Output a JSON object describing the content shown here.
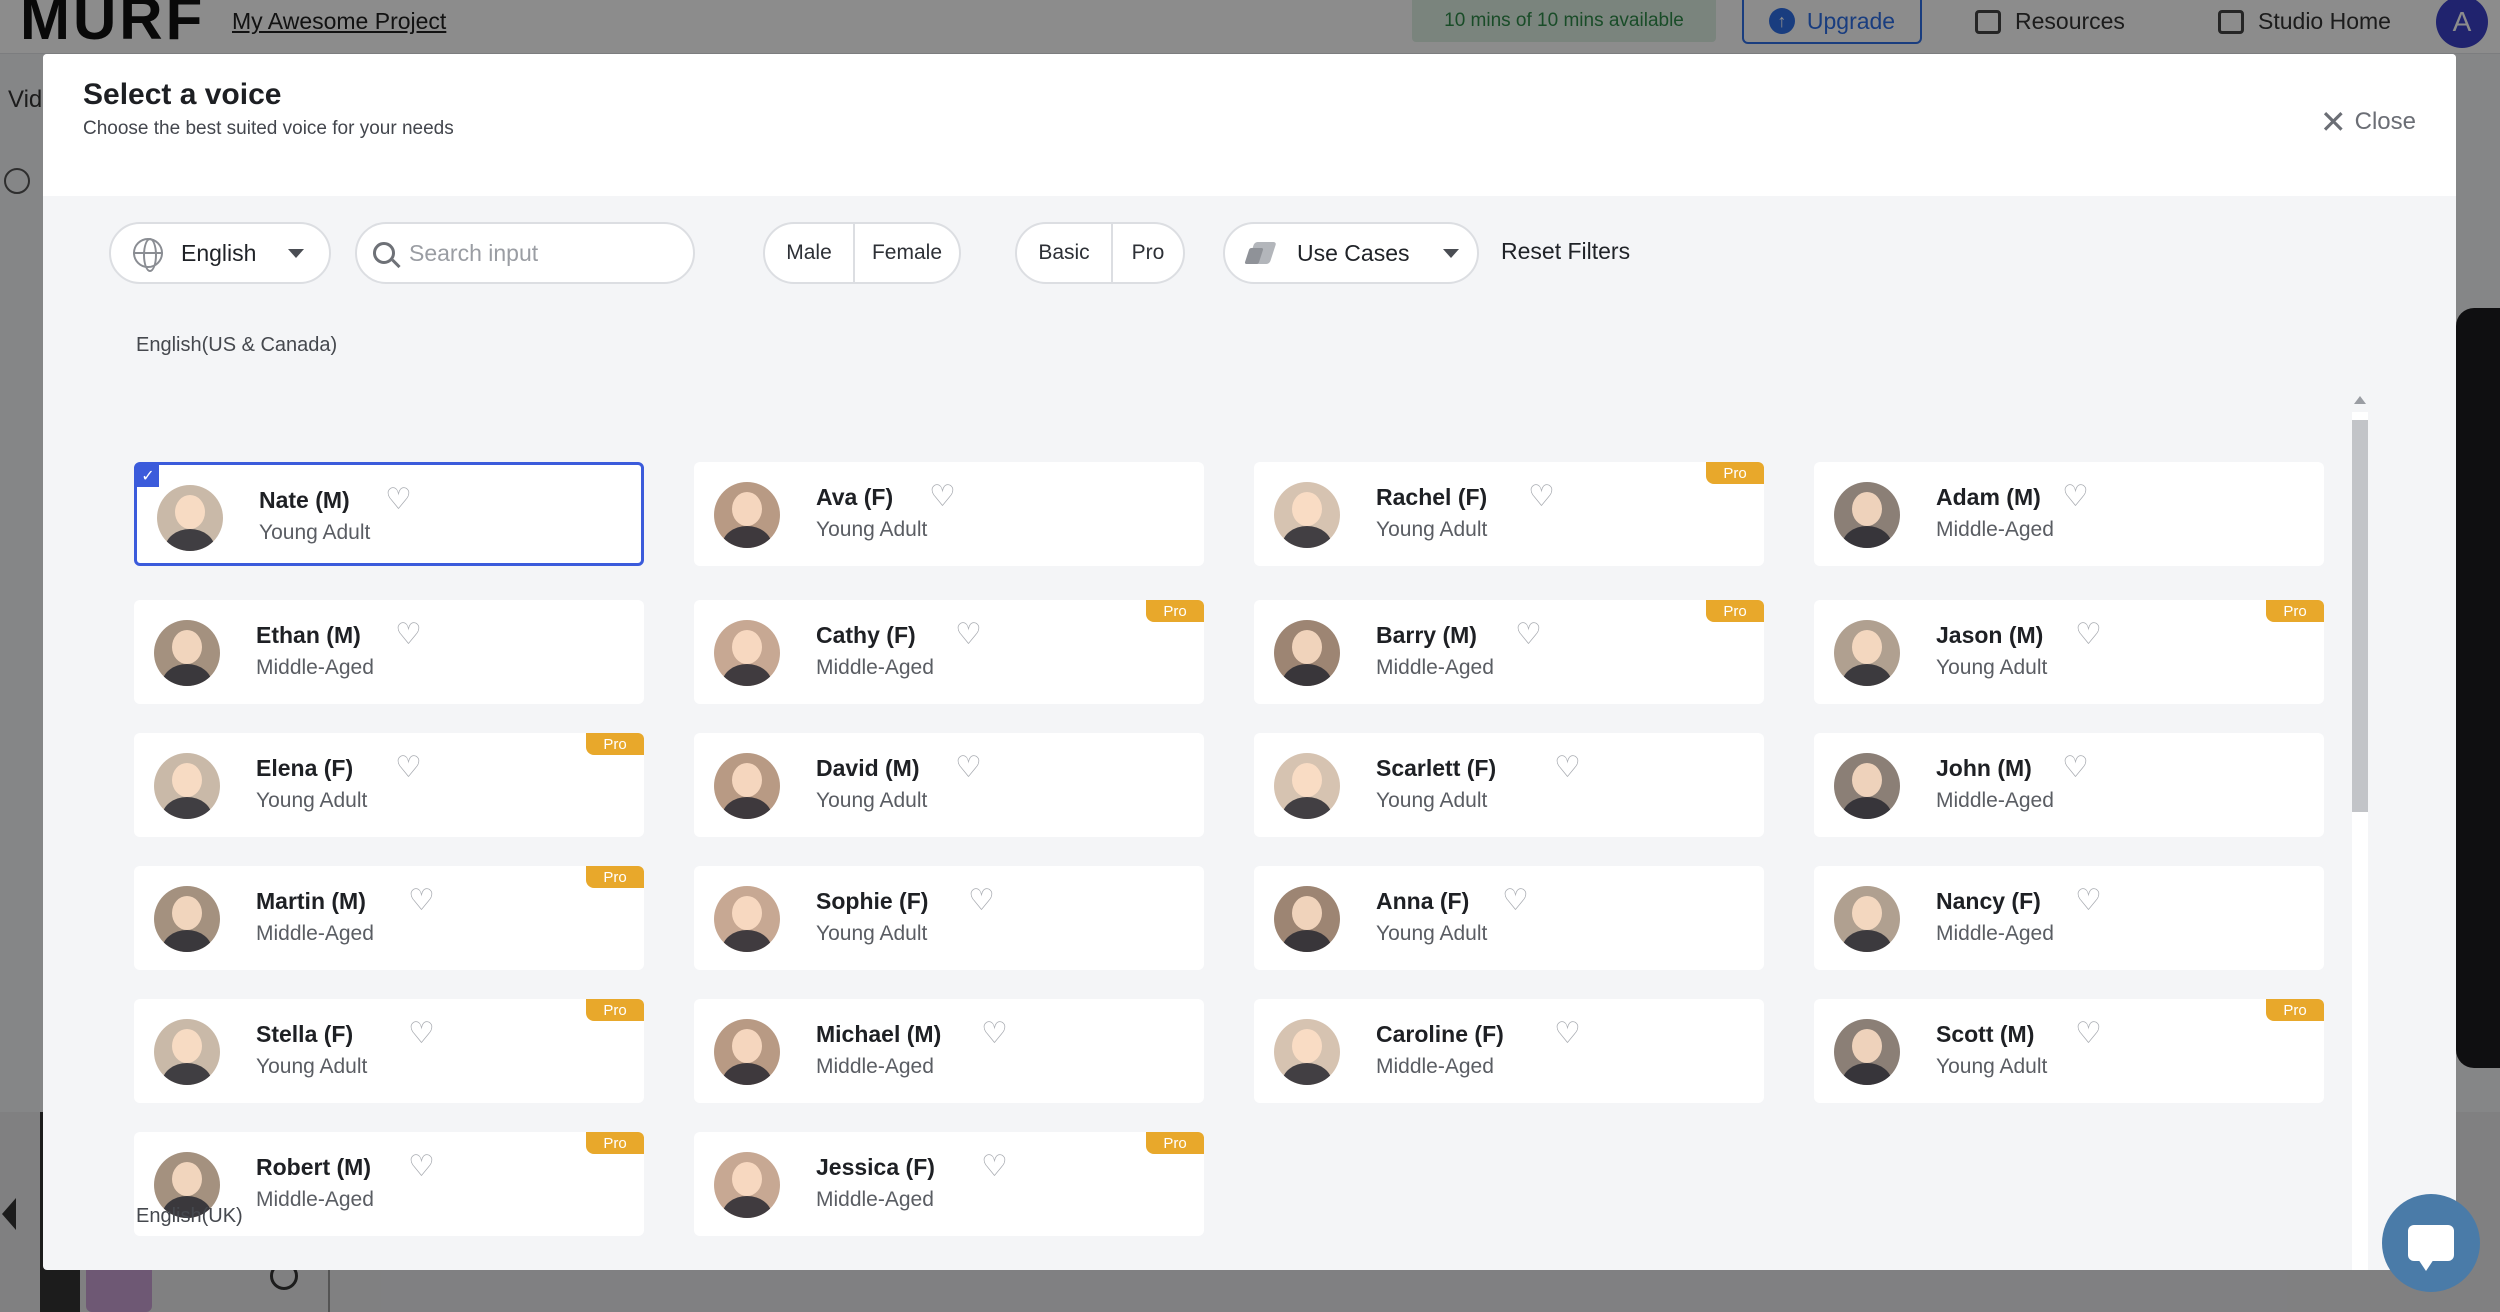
{
  "background_app": {
    "logo": "MURF",
    "project_name": "My Awesome Project",
    "minutes_available": "10 mins of 10 mins available",
    "upgrade_label": "Upgrade",
    "resources_label": "Resources",
    "studio_home_label": "Studio Home",
    "avatar_initial": "A",
    "side_label": "Vid"
  },
  "modal": {
    "title": "Select a voice",
    "subtitle": "Choose the best suited voice for your needs",
    "close_label": "Close"
  },
  "filters": {
    "language": "English",
    "search_placeholder": "Search input",
    "gender_options": [
      "Male",
      "Female"
    ],
    "tier_options": [
      "Basic",
      "Pro"
    ],
    "use_cases_label": "Use Cases",
    "reset_label": "Reset Filters"
  },
  "pro_label": "Pro",
  "sections": [
    {
      "label": "English(US & Canada)",
      "voices": [
        {
          "name": "Nate (M)",
          "age": "Young Adult",
          "pro": false,
          "selected": true
        },
        {
          "name": "Ava (F)",
          "age": "Young Adult",
          "pro": false
        },
        {
          "name": "Rachel (F)",
          "age": "Young Adult",
          "pro": true
        },
        {
          "name": "Adam (M)",
          "age": "Middle-Aged",
          "pro": false
        },
        {
          "name": "Ethan (M)",
          "age": "Middle-Aged",
          "pro": false
        },
        {
          "name": "Cathy (F)",
          "age": "Middle-Aged",
          "pro": true
        },
        {
          "name": "Barry (M)",
          "age": "Middle-Aged",
          "pro": true
        },
        {
          "name": "Jason (M)",
          "age": "Young Adult",
          "pro": true
        },
        {
          "name": "Elena (F)",
          "age": "Young Adult",
          "pro": true
        },
        {
          "name": "David (M)",
          "age": "Young Adult",
          "pro": false
        },
        {
          "name": "Scarlett (F)",
          "age": "Young Adult",
          "pro": false
        },
        {
          "name": "John (M)",
          "age": "Middle-Aged",
          "pro": false
        },
        {
          "name": "Martin (M)",
          "age": "Middle-Aged",
          "pro": true
        },
        {
          "name": "Sophie (F)",
          "age": "Young Adult",
          "pro": false
        },
        {
          "name": "Anna (F)",
          "age": "Young Adult",
          "pro": false
        },
        {
          "name": "Nancy (F)",
          "age": "Middle-Aged",
          "pro": false
        },
        {
          "name": "Stella (F)",
          "age": "Young Adult",
          "pro": true
        },
        {
          "name": "Michael (M)",
          "age": "Middle-Aged",
          "pro": false
        },
        {
          "name": "Caroline (F)",
          "age": "Middle-Aged",
          "pro": false
        },
        {
          "name": "Scott (M)",
          "age": "Young Adult",
          "pro": true
        },
        {
          "name": "Robert (M)",
          "age": "Middle-Aged",
          "pro": true
        },
        {
          "name": "Jessica (F)",
          "age": "Middle-Aged",
          "pro": true
        }
      ]
    },
    {
      "label": "English(UK)",
      "voices": []
    }
  ],
  "colors": {
    "accent": "#3b5bdb",
    "pro_badge": "#e8a82b",
    "upgrade": "#2e6fe8"
  }
}
